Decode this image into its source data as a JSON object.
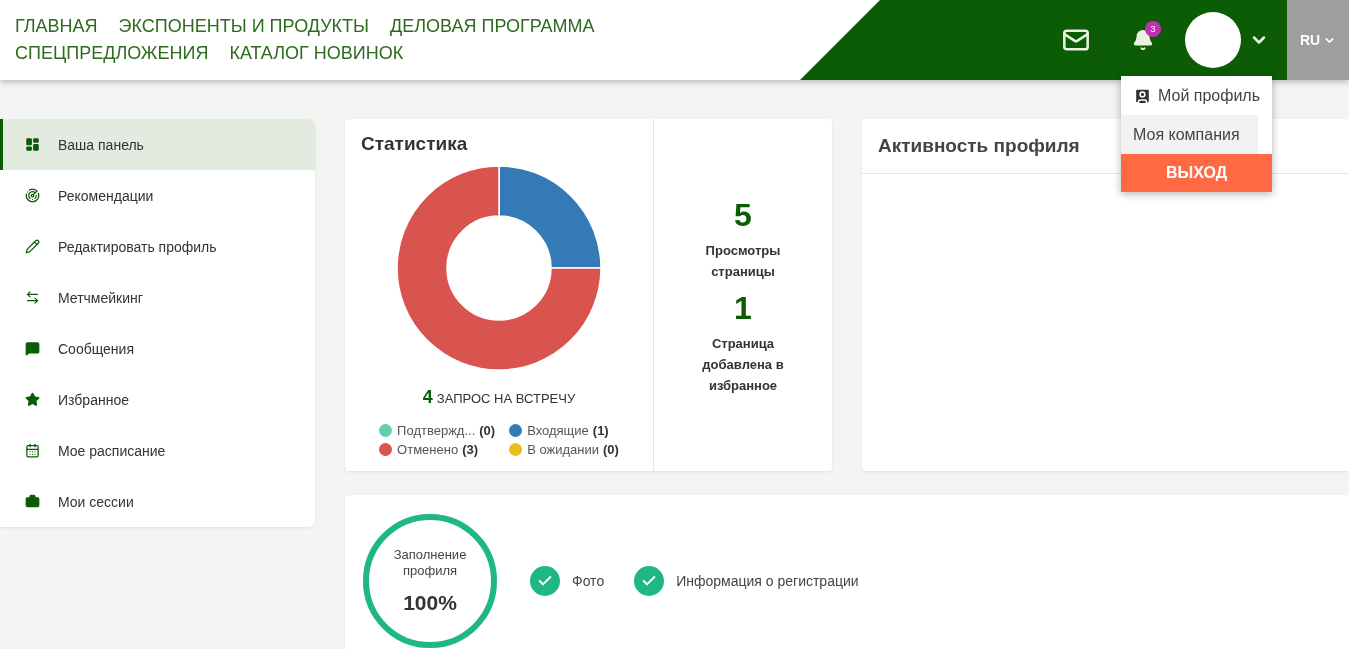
{
  "nav": [
    {
      "label": "ГЛАВНАЯ"
    },
    {
      "label": "ЭКСПОНЕНТЫ И ПРОДУКТЫ"
    },
    {
      "label": "ДЕЛОВАЯ ПРОГРАММА"
    },
    {
      "label": "СПЕЦПРЕДЛОЖЕНИЯ"
    },
    {
      "label": "КАТАЛОГ НОВИНОК"
    }
  ],
  "header": {
    "notifications_badge": "3",
    "language": "RU"
  },
  "user_menu": [
    {
      "kind": "link",
      "label": "Мой профиль",
      "hovered": false
    },
    {
      "kind": "link-plain",
      "label": "Моя компания",
      "hovered": true
    },
    {
      "kind": "logout",
      "label": "ВЫХОД",
      "hovered": false
    }
  ],
  "sidebar": {
    "items": [
      {
        "label": "Ваша панель",
        "selected": true
      },
      {
        "label": "Рекомендации",
        "selected": false
      },
      {
        "label": "Редактировать профиль",
        "selected": false
      },
      {
        "label": "Метчмейкинг",
        "selected": false
      },
      {
        "label": "Сообщения",
        "selected": false
      },
      {
        "label": "Избранное",
        "selected": false
      },
      {
        "label": "Мое расписание",
        "selected": false
      },
      {
        "label": "Мои сессии",
        "selected": false
      }
    ]
  },
  "statistics": {
    "title": "Статистика",
    "chart_data": {
      "type": "donut",
      "values": [
        0,
        25,
        75,
        0
      ]
    },
    "total_count": "4",
    "total_label": "ЗАПРОС НА ВСТРЕЧУ",
    "legend": [
      {
        "label": "Подтвержд...",
        "count": "(0)",
        "color": "#5ecfb1"
      },
      {
        "label": "Входящие",
        "count": "(1)",
        "color": "#337ab7"
      },
      {
        "label": "Отменено",
        "count": "(3)",
        "color": "#d9534f"
      },
      {
        "label": "В ожидании",
        "count": "(0)",
        "color": "#e6be1e"
      }
    ],
    "counters": [
      {
        "value": "5",
        "label": "Просмотры страницы"
      },
      {
        "value": "1",
        "label": "Страница добавлена в избранное"
      }
    ]
  },
  "activity": {
    "title": "Активность профиля"
  },
  "completion": {
    "label": "Заполнение профиля",
    "percent": "100%",
    "level": 1,
    "checks": [
      {
        "label": "Фото",
        "checked": true
      },
      {
        "label": "Информация о регистрации",
        "checked": true
      }
    ]
  }
}
